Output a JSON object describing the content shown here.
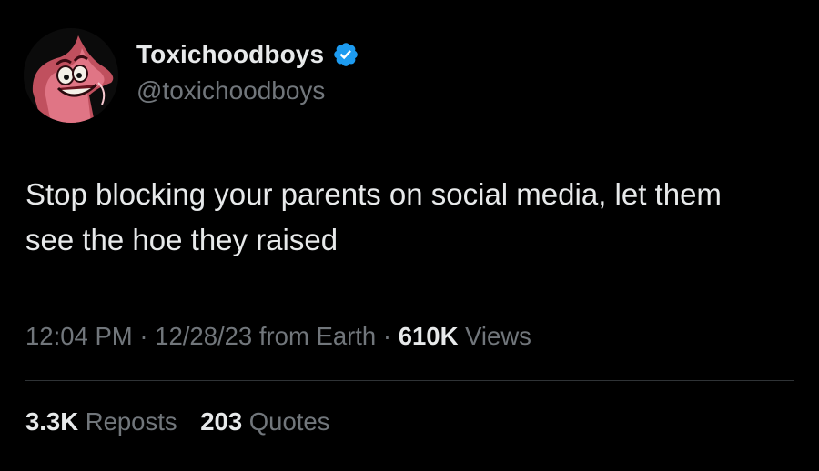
{
  "author": {
    "display_name": "Toxichoodboys",
    "handle": "@toxichoodboys",
    "verified": true,
    "verified_color": "#1d9bf0",
    "avatar_icon": "patrick-star-avatar"
  },
  "tweet": {
    "text": "Stop blocking your parents on social media, let them see the hoe they raised"
  },
  "meta": {
    "time": "12:04 PM",
    "separator": "·",
    "date": "12/28/23",
    "source": "from Earth",
    "views_count": "610K",
    "views_label": "Views"
  },
  "stats": {
    "reposts_count": "3.3K",
    "reposts_label": "Reposts",
    "quotes_count": "203",
    "quotes_label": "Quotes"
  },
  "colors": {
    "background": "#000000",
    "text_primary": "#e7e9ea",
    "text_secondary": "#71767b",
    "divider": "#2f3336"
  }
}
